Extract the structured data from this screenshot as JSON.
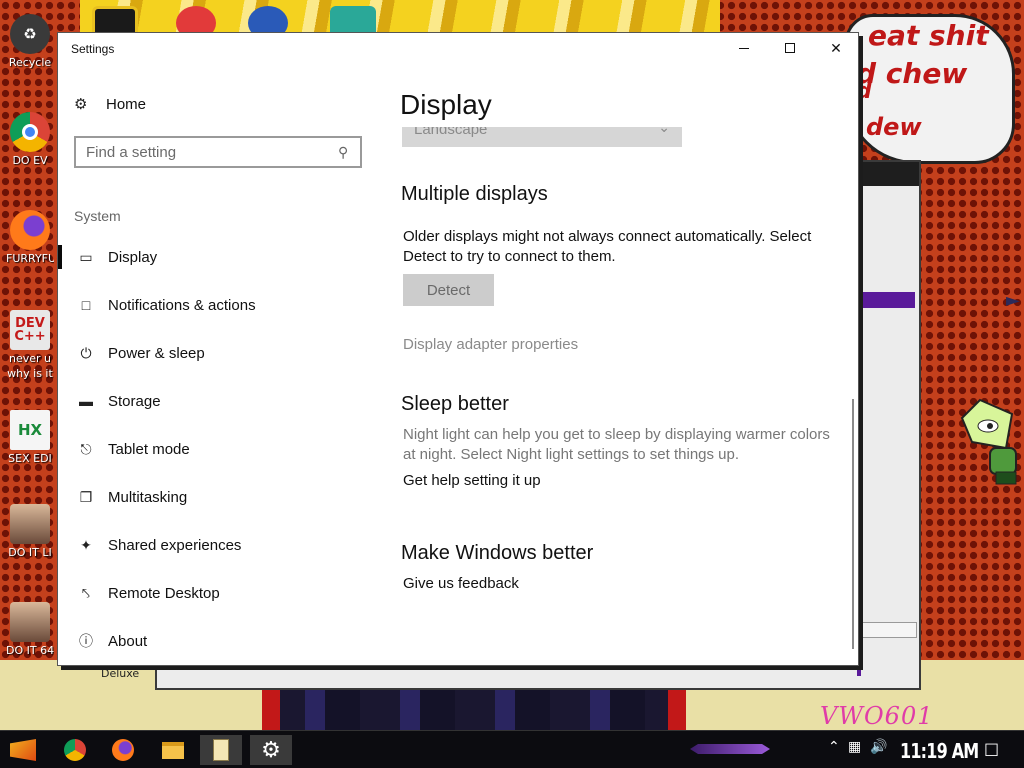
{
  "settings_window": {
    "title": "Settings",
    "home_label": "Home",
    "search_placeholder": "Find a setting",
    "section_label": "System",
    "nav": [
      {
        "label": "Display",
        "icon": "monitor-icon",
        "active": true
      },
      {
        "label": "Notifications & actions",
        "icon": "notification-icon",
        "active": false
      },
      {
        "label": "Power & sleep",
        "icon": "power-icon",
        "active": false
      },
      {
        "label": "Storage",
        "icon": "storage-icon",
        "active": false
      },
      {
        "label": "Tablet mode",
        "icon": "tablet-mode-icon",
        "active": false
      },
      {
        "label": "Multitasking",
        "icon": "multitasking-icon",
        "active": false
      },
      {
        "label": "Shared experiences",
        "icon": "shared-experiences-icon",
        "active": false
      },
      {
        "label": "Remote Desktop",
        "icon": "remote-desktop-icon",
        "active": false
      },
      {
        "label": "About",
        "icon": "info-icon",
        "active": false
      }
    ],
    "content": {
      "page_title": "Display",
      "orientation_value": "Landscape",
      "multiple_displays": {
        "heading": "Multiple displays",
        "description": "Older displays might not always connect automatically. Select Detect to try to connect to them.",
        "detect_label": "Detect",
        "adapter_link": "Display adapter properties"
      },
      "sleep_better": {
        "heading": "Sleep better",
        "description": "Night light can help you get to sleep by displaying warmer colors at night. Select Night light settings to set things up.",
        "help_link": "Get help setting it up"
      },
      "make_better": {
        "heading": "Make Windows better",
        "feedback_link": "Give us feedback"
      }
    }
  },
  "desktop": {
    "icons": [
      {
        "caption": "Recycle",
        "glyph": "recycle-bin-icon",
        "color": "#3a3a3a"
      },
      {
        "caption": "DO EV",
        "glyph": "chrome-icon",
        "color": "#1a73e8"
      },
      {
        "caption": "FURRYFU",
        "glyph": "firefox-icon",
        "color": "#e66000"
      },
      {
        "caption": "never u",
        "glyph": "dev-cpp-icon",
        "color": "#c41a1a"
      },
      {
        "caption": "why is it",
        "glyph": "",
        "color": ""
      },
      {
        "caption": "SEX EDI",
        "glyph": "hex-editor-icon",
        "color": "#f0f0f0"
      },
      {
        "caption": "DO IT LI",
        "glyph": "portrait-icon",
        "color": "#6a4a3a"
      },
      {
        "caption": "DO IT 64",
        "glyph": "portrait-icon",
        "color": "#6a4a3a"
      }
    ],
    "speech_lines": [
      "eat shit",
      "d chew",
      "d",
      "dew"
    ],
    "watermark": "VWO601",
    "deluxe_label": "Deluxe"
  },
  "taskbar": {
    "items": [
      {
        "name": "start-button",
        "icon": "start-logo-icon"
      },
      {
        "name": "chrome",
        "icon": "chrome-icon"
      },
      {
        "name": "firefox",
        "icon": "firefox-icon"
      },
      {
        "name": "file-explorer",
        "icon": "folder-icon"
      },
      {
        "name": "notepad",
        "icon": "notepad-icon"
      },
      {
        "name": "settings",
        "icon": "gear-icon"
      }
    ],
    "clock": "11:19 AM"
  }
}
